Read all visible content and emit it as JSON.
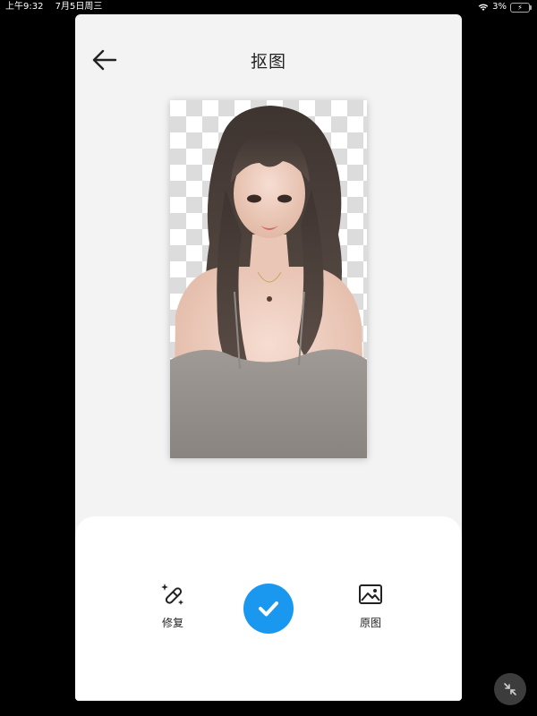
{
  "status_bar": {
    "time": "上午9:32",
    "date": "7月5日周三",
    "battery": "3%"
  },
  "header": {
    "title": "抠图",
    "back_icon": "arrow-left-icon"
  },
  "preview": {
    "background": "transparency-checkerboard"
  },
  "toolbar": {
    "repair_label": "修复",
    "repair_icon": "magic-wand-icon",
    "confirm_icon": "checkmark-icon",
    "original_label": "原图",
    "original_icon": "image-icon"
  },
  "floating_button": {
    "icon": "collapse-icon"
  },
  "colors": {
    "accent": "#1a98f0",
    "sheet_background": "#f3f3f3",
    "panel_background": "#ffffff"
  }
}
